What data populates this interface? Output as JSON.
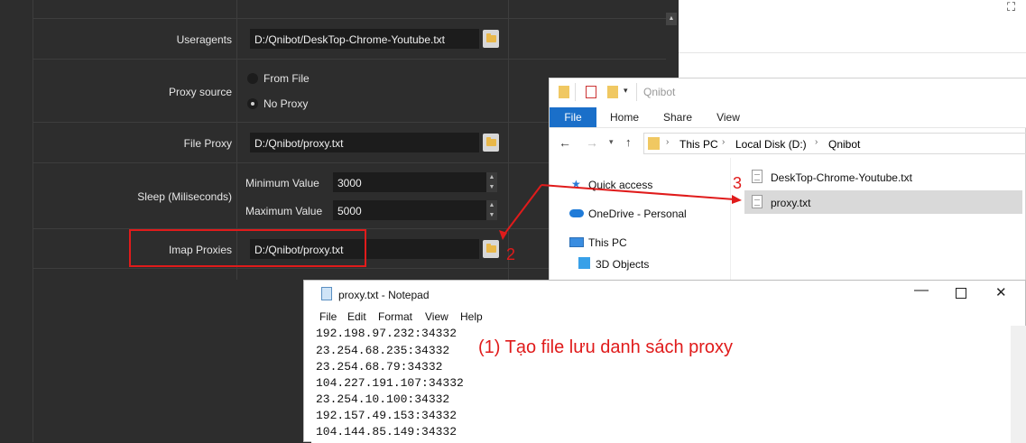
{
  "settings": {
    "useragents_label": "Useragents",
    "useragents_value": "D:/Qnibot/DeskTop-Chrome-Youtube.txt",
    "proxy_source_label": "Proxy source",
    "proxy_source_options": [
      {
        "label": "From File",
        "selected": false
      },
      {
        "label": "No Proxy",
        "selected": true
      }
    ],
    "file_proxy_label": "File Proxy",
    "file_proxy_value": "D:/Qnibot/proxy.txt",
    "sleep_label": "Sleep (Miliseconds)",
    "min_label": "Minimum Value",
    "min_value": "3000",
    "max_label": "Maximum Value",
    "max_value": "5000",
    "imap_label": "Imap Proxies",
    "imap_value": "D:/Qnibot/proxy.txt"
  },
  "explorer": {
    "title": "Qnibot",
    "ribbon_tabs": [
      "File",
      "Home",
      "Share",
      "View"
    ],
    "breadcrumb": [
      "This PC",
      "Local Disk (D:)",
      "Qnibot"
    ],
    "nav": [
      "Quick access",
      "OneDrive - Personal",
      "This PC",
      "3D Objects"
    ],
    "files": [
      "DeskTop-Chrome-Youtube.txt",
      "proxy.txt"
    ]
  },
  "notepad": {
    "title": "proxy.txt - Notepad",
    "menu": [
      "File",
      "Edit",
      "Format",
      "View",
      "Help"
    ],
    "lines": [
      "192.198.97.232:34332",
      "23.254.68.235:34332",
      "23.254.68.79:34332",
      "104.227.191.107:34332",
      "23.254.10.100:34332",
      "192.157.49.153:34332",
      "104.144.85.149:34332"
    ]
  },
  "annotations": {
    "step1": "(1) Tạo file lưu danh sách proxy",
    "step2": "2",
    "step3": "3",
    "accent": "#e01b1b"
  }
}
